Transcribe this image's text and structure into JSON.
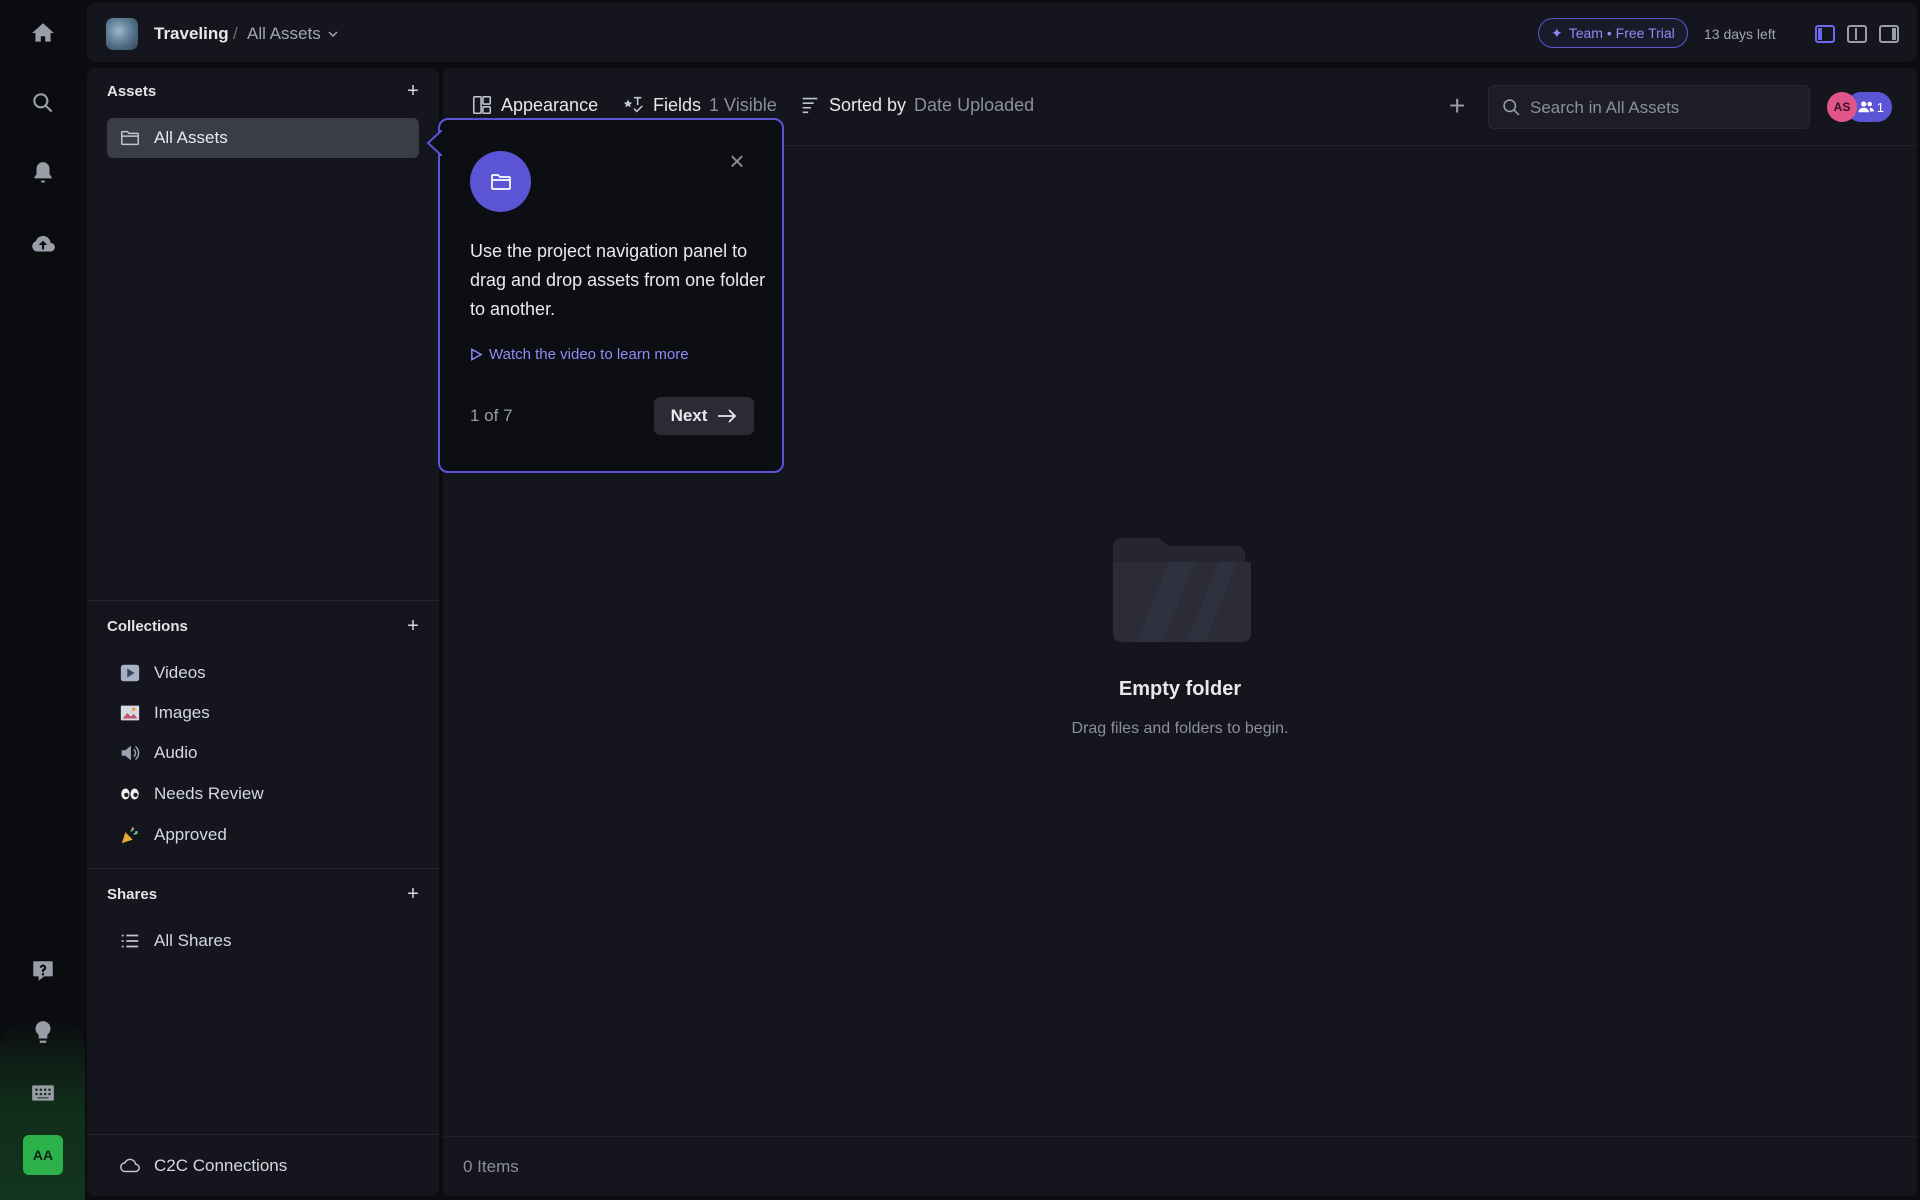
{
  "topbar": {
    "project_name": "Traveling",
    "separator": "/",
    "current_folder": "All Assets",
    "trial_badge": "Team • Free Trial",
    "days_left": "13 days left"
  },
  "rail": {
    "avatar_initials": "AA"
  },
  "sidebar": {
    "assets": {
      "title": "Assets",
      "items": [
        {
          "label": "All Assets",
          "selected": true
        }
      ]
    },
    "collections": {
      "title": "Collections",
      "items": [
        {
          "label": "Videos",
          "icon": "play-emoji"
        },
        {
          "label": "Images",
          "icon": "image-emoji"
        },
        {
          "label": "Audio",
          "icon": "speaker-emoji"
        },
        {
          "label": "Needs Review",
          "icon": "eyes-emoji"
        },
        {
          "label": "Approved",
          "icon": "party-popper-emoji"
        }
      ]
    },
    "shares": {
      "title": "Shares",
      "items": [
        {
          "label": "All Shares"
        }
      ]
    },
    "footer_item": "C2C Connections"
  },
  "toolbar": {
    "appearance": "Appearance",
    "fields": "Fields",
    "fields_count": "1 Visible",
    "sorted_by": "Sorted by",
    "sorted_value": "Date Uploaded",
    "search_placeholder": "Search in All Assets",
    "avatar_initials": "AS",
    "member_count": "1"
  },
  "main": {
    "empty_title": "Empty folder",
    "empty_subtitle": "Drag files and folders to begin.",
    "item_count": "0 Items"
  },
  "popover": {
    "text": "Use the project navigation panel to drag and drop assets from one folder to another.",
    "link": "Watch the video to learn more",
    "step": "1 of 7",
    "next": "Next"
  },
  "colors": {
    "accent": "#5b55d6",
    "panel": "#14151d",
    "background": "#0b0c10",
    "avatar_green": "#2bb24a",
    "avatar_pink": "#e0558a"
  }
}
